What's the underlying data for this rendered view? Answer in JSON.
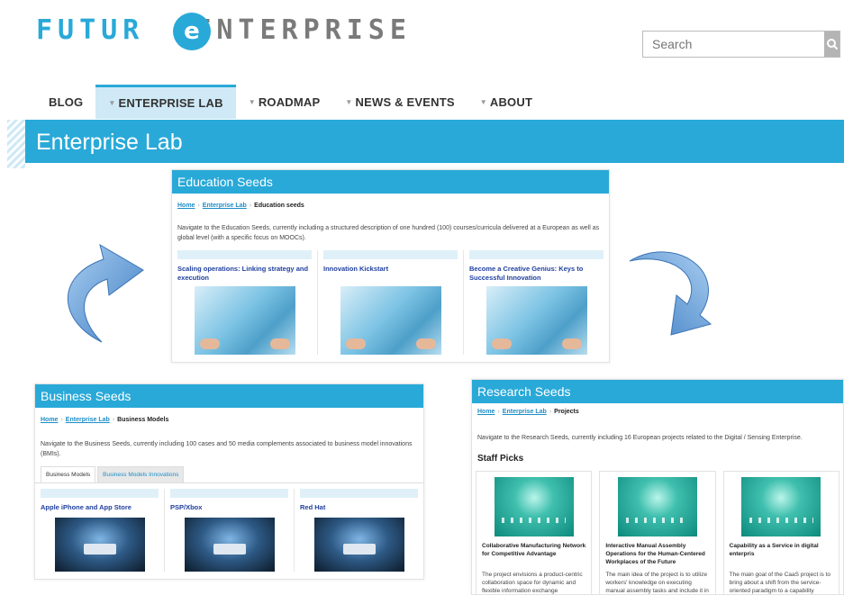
{
  "logo": {
    "part1": "FUTUR",
    "part2": "ENTERPRISE",
    "circle_letter": "e"
  },
  "search": {
    "placeholder": "Search"
  },
  "nav": [
    "BLOG",
    "ENTERPRISE LAB",
    "ROADMAP",
    "NEWS & EVENTS",
    "ABOUT"
  ],
  "banner": {
    "title": "Enterprise Lab"
  },
  "education": {
    "title": "Education Seeds",
    "crumbs": [
      "Home",
      "Enterprise Lab",
      "Education seeds"
    ],
    "intro": "Navigate to the Education Seeds, currently including a structured description of one hundred (100) courses/curricula delivered at a European as well as global level (with a specific focus on MOOCs).",
    "cards": [
      "Scaling operations: Linking strategy and execution",
      "Innovation Kickstart",
      "Become a Creative Genius: Keys to Successful Innovation"
    ]
  },
  "business": {
    "title": "Business Seeds",
    "crumbs": [
      "Home",
      "Enterprise Lab",
      "Business Models"
    ],
    "intro": "Navigate to the Business Seeds, currently including 100 cases and 50 media complements associated to business model innovations (BMIs).",
    "tabs": [
      "Business Models",
      "Business Models Innovations"
    ],
    "cards": [
      "Apple iPhone and App Store",
      "PSP/Xbox",
      "Red Hat"
    ]
  },
  "research": {
    "title": "Research Seeds",
    "crumbs": [
      "Home",
      "Enterprise Lab",
      "Projects"
    ],
    "intro": "Navigate to the Research Seeds, currently including 16 European projects related to the Digital / Sensing Enterprise.",
    "staff": "Staff Picks",
    "cards": [
      {
        "title": "Collaborative Manufacturing Network for Competitive Advantage",
        "desc": "The project envisions a product-centric collaboration space for dynamic and flexible information exchange between..."
      },
      {
        "title": "Interactive Manual Assembly Operations for the Human-Centered Workplaces of the Future",
        "desc": "The main idea of the project is to utilize workers' knowledge on executing manual assembly tasks and include it in the..."
      },
      {
        "title": "Capability as a Service in digital enterpris",
        "desc": "The main goal of the CaaS project is to bring about a shift from the service-oriented paradigm to a capability delivery..."
      }
    ]
  },
  "colors": {
    "accent": "#29a9d8",
    "nav_active_bg": "#cfe9f6",
    "arrow": "#5a9ed8"
  }
}
